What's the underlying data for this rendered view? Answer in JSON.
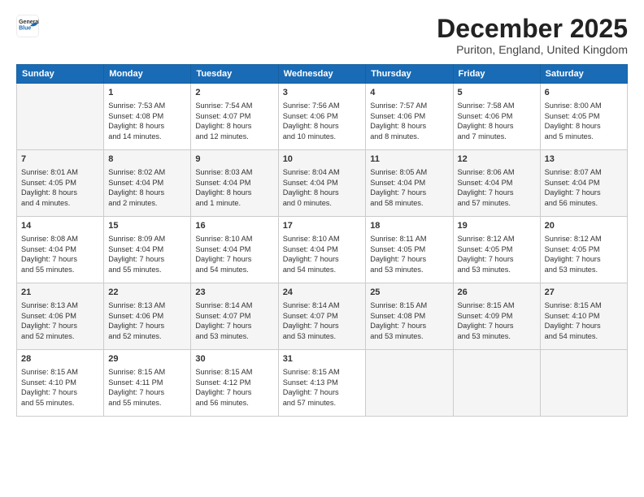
{
  "header": {
    "logo": {
      "line1": "General",
      "line2": "Blue"
    },
    "month": "December 2025",
    "location": "Puriton, England, United Kingdom"
  },
  "weekdays": [
    "Sunday",
    "Monday",
    "Tuesday",
    "Wednesday",
    "Thursday",
    "Friday",
    "Saturday"
  ],
  "weeks": [
    [
      {
        "day": "",
        "info": ""
      },
      {
        "day": "1",
        "info": "Sunrise: 7:53 AM\nSunset: 4:08 PM\nDaylight: 8 hours\nand 14 minutes."
      },
      {
        "day": "2",
        "info": "Sunrise: 7:54 AM\nSunset: 4:07 PM\nDaylight: 8 hours\nand 12 minutes."
      },
      {
        "day": "3",
        "info": "Sunrise: 7:56 AM\nSunset: 4:06 PM\nDaylight: 8 hours\nand 10 minutes."
      },
      {
        "day": "4",
        "info": "Sunrise: 7:57 AM\nSunset: 4:06 PM\nDaylight: 8 hours\nand 8 minutes."
      },
      {
        "day": "5",
        "info": "Sunrise: 7:58 AM\nSunset: 4:06 PM\nDaylight: 8 hours\nand 7 minutes."
      },
      {
        "day": "6",
        "info": "Sunrise: 8:00 AM\nSunset: 4:05 PM\nDaylight: 8 hours\nand 5 minutes."
      }
    ],
    [
      {
        "day": "7",
        "info": "Sunrise: 8:01 AM\nSunset: 4:05 PM\nDaylight: 8 hours\nand 4 minutes."
      },
      {
        "day": "8",
        "info": "Sunrise: 8:02 AM\nSunset: 4:04 PM\nDaylight: 8 hours\nand 2 minutes."
      },
      {
        "day": "9",
        "info": "Sunrise: 8:03 AM\nSunset: 4:04 PM\nDaylight: 8 hours\nand 1 minute."
      },
      {
        "day": "10",
        "info": "Sunrise: 8:04 AM\nSunset: 4:04 PM\nDaylight: 8 hours\nand 0 minutes."
      },
      {
        "day": "11",
        "info": "Sunrise: 8:05 AM\nSunset: 4:04 PM\nDaylight: 7 hours\nand 58 minutes."
      },
      {
        "day": "12",
        "info": "Sunrise: 8:06 AM\nSunset: 4:04 PM\nDaylight: 7 hours\nand 57 minutes."
      },
      {
        "day": "13",
        "info": "Sunrise: 8:07 AM\nSunset: 4:04 PM\nDaylight: 7 hours\nand 56 minutes."
      }
    ],
    [
      {
        "day": "14",
        "info": "Sunrise: 8:08 AM\nSunset: 4:04 PM\nDaylight: 7 hours\nand 55 minutes."
      },
      {
        "day": "15",
        "info": "Sunrise: 8:09 AM\nSunset: 4:04 PM\nDaylight: 7 hours\nand 55 minutes."
      },
      {
        "day": "16",
        "info": "Sunrise: 8:10 AM\nSunset: 4:04 PM\nDaylight: 7 hours\nand 54 minutes."
      },
      {
        "day": "17",
        "info": "Sunrise: 8:10 AM\nSunset: 4:04 PM\nDaylight: 7 hours\nand 54 minutes."
      },
      {
        "day": "18",
        "info": "Sunrise: 8:11 AM\nSunset: 4:05 PM\nDaylight: 7 hours\nand 53 minutes."
      },
      {
        "day": "19",
        "info": "Sunrise: 8:12 AM\nSunset: 4:05 PM\nDaylight: 7 hours\nand 53 minutes."
      },
      {
        "day": "20",
        "info": "Sunrise: 8:12 AM\nSunset: 4:05 PM\nDaylight: 7 hours\nand 53 minutes."
      }
    ],
    [
      {
        "day": "21",
        "info": "Sunrise: 8:13 AM\nSunset: 4:06 PM\nDaylight: 7 hours\nand 52 minutes."
      },
      {
        "day": "22",
        "info": "Sunrise: 8:13 AM\nSunset: 4:06 PM\nDaylight: 7 hours\nand 52 minutes."
      },
      {
        "day": "23",
        "info": "Sunrise: 8:14 AM\nSunset: 4:07 PM\nDaylight: 7 hours\nand 53 minutes."
      },
      {
        "day": "24",
        "info": "Sunrise: 8:14 AM\nSunset: 4:07 PM\nDaylight: 7 hours\nand 53 minutes."
      },
      {
        "day": "25",
        "info": "Sunrise: 8:15 AM\nSunset: 4:08 PM\nDaylight: 7 hours\nand 53 minutes."
      },
      {
        "day": "26",
        "info": "Sunrise: 8:15 AM\nSunset: 4:09 PM\nDaylight: 7 hours\nand 53 minutes."
      },
      {
        "day": "27",
        "info": "Sunrise: 8:15 AM\nSunset: 4:10 PM\nDaylight: 7 hours\nand 54 minutes."
      }
    ],
    [
      {
        "day": "28",
        "info": "Sunrise: 8:15 AM\nSunset: 4:10 PM\nDaylight: 7 hours\nand 55 minutes."
      },
      {
        "day": "29",
        "info": "Sunrise: 8:15 AM\nSunset: 4:11 PM\nDaylight: 7 hours\nand 55 minutes."
      },
      {
        "day": "30",
        "info": "Sunrise: 8:15 AM\nSunset: 4:12 PM\nDaylight: 7 hours\nand 56 minutes."
      },
      {
        "day": "31",
        "info": "Sunrise: 8:15 AM\nSunset: 4:13 PM\nDaylight: 7 hours\nand 57 minutes."
      },
      {
        "day": "",
        "info": ""
      },
      {
        "day": "",
        "info": ""
      },
      {
        "day": "",
        "info": ""
      }
    ]
  ]
}
